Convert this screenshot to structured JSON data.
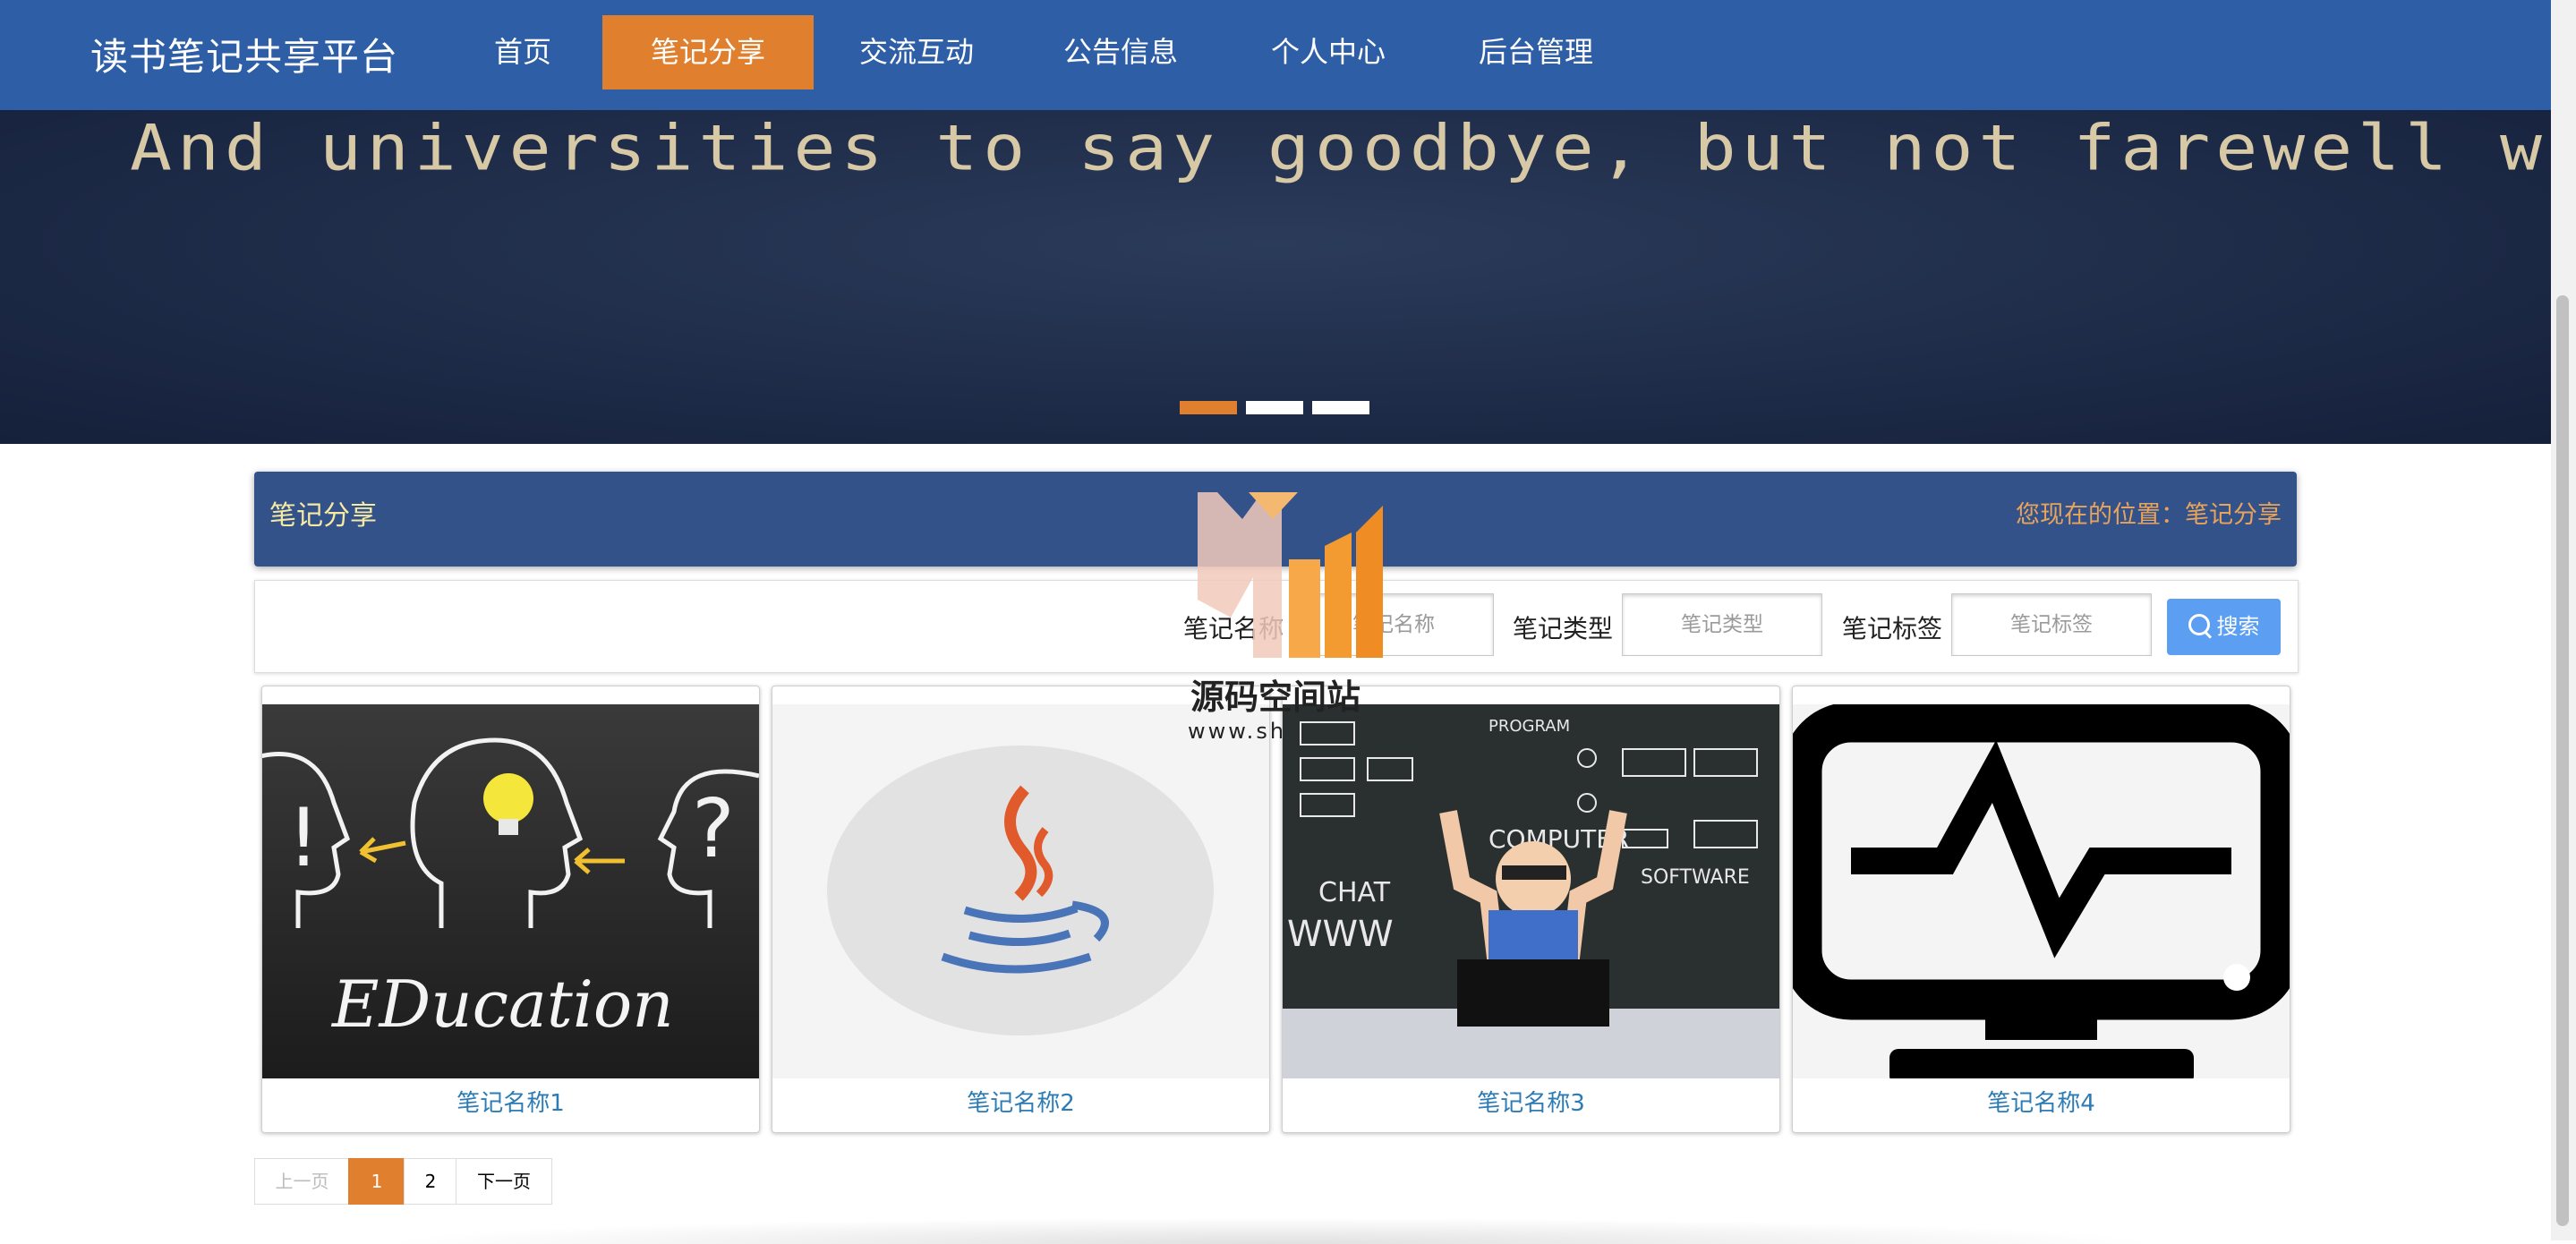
{
  "header": {
    "brand": "读书笔记共享平台",
    "nav": [
      {
        "label": "首页",
        "active": false
      },
      {
        "label": "笔记分享",
        "active": true
      },
      {
        "label": "交流互动",
        "active": false
      },
      {
        "label": "公告信息",
        "active": false
      },
      {
        "label": "个人中心",
        "active": false
      },
      {
        "label": "后台管理",
        "active": false
      }
    ],
    "nav_color": "#2d5ea6",
    "active_color": "#e0802f"
  },
  "banner": {
    "text": "And universities to say goodbye, but not farewell with youth",
    "slides": 3,
    "active_slide": 1
  },
  "section": {
    "title": "笔记分享",
    "location": "您现在的位置：笔记分享"
  },
  "search": {
    "name_label": "笔记名称",
    "name_placeholder": "笔记名称",
    "type_label": "笔记类型",
    "type_placeholder": "笔记类型",
    "tag_label": "笔记标签",
    "tag_placeholder": "笔记标签",
    "button": "搜索"
  },
  "cards": [
    {
      "name": "笔记名称1",
      "image": "education-chalkboard"
    },
    {
      "name": "笔记名称2",
      "image": "java-logo"
    },
    {
      "name": "笔记名称3",
      "image": "boy-computer-chalkboard"
    },
    {
      "name": "笔记名称4",
      "image": "monitor-pulse-icon"
    }
  ],
  "pagination": {
    "prev": "上一页",
    "pages": [
      "1",
      "2"
    ],
    "current": "1",
    "next": "下一页"
  },
  "watermark": {
    "text": "源码空间站",
    "url": "www.sh"
  }
}
